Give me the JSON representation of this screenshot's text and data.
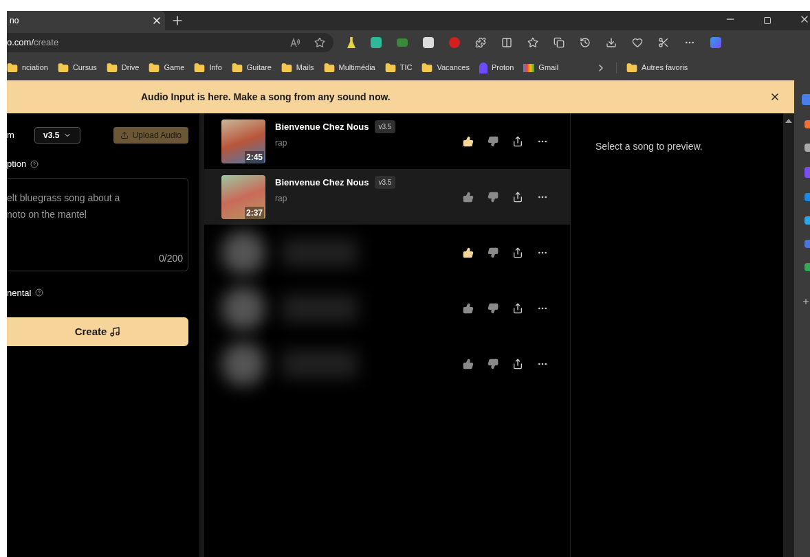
{
  "browser": {
    "tab_title": "no",
    "address": {
      "domain": "o.com/",
      "path": "create"
    },
    "bookmarks": [
      {
        "label": "nciation",
        "kind": "folder"
      },
      {
        "label": "Cursus",
        "kind": "folder"
      },
      {
        "label": "Drive",
        "kind": "folder"
      },
      {
        "label": "Game",
        "kind": "folder"
      },
      {
        "label": "Info",
        "kind": "folder"
      },
      {
        "label": "Guitare",
        "kind": "folder"
      },
      {
        "label": "Mails",
        "kind": "folder"
      },
      {
        "label": "Multimédia",
        "kind": "folder"
      },
      {
        "label": "TIC",
        "kind": "folder"
      },
      {
        "label": "Vacances",
        "kind": "folder"
      },
      {
        "label": "Proton",
        "kind": "proton"
      },
      {
        "label": "Gmail",
        "kind": "gmail"
      }
    ],
    "other_bookmarks": "Autres favoris"
  },
  "banner": {
    "text": "Audio Input is here. Make a song from any sound now."
  },
  "create_panel": {
    "model_label": "m",
    "model_value": "v3.5",
    "upload_button": "Upload Audio",
    "description_label": "ption",
    "description_placeholder": "elt bluegrass song about a\nnoto on the mantel",
    "char_count": "0/200",
    "instrumental_label": "nental",
    "create_button": "Create"
  },
  "songs": [
    {
      "kind": "song",
      "title": "Bienvenue Chez Nous",
      "version": "v3.5",
      "genre": "rap",
      "duration": "2:45",
      "liked": true,
      "selected": false
    },
    {
      "kind": "song",
      "title": "Bienvenue Chez Nous",
      "version": "v3.5",
      "genre": "rap",
      "duration": "2:37",
      "liked": false,
      "selected": true
    },
    {
      "kind": "blurred",
      "liked": true,
      "selected": false
    },
    {
      "kind": "blurred",
      "liked": false,
      "selected": false
    },
    {
      "kind": "blurred",
      "liked": false,
      "selected": false
    }
  ],
  "preview": {
    "empty_text": "Select a song to preview."
  }
}
